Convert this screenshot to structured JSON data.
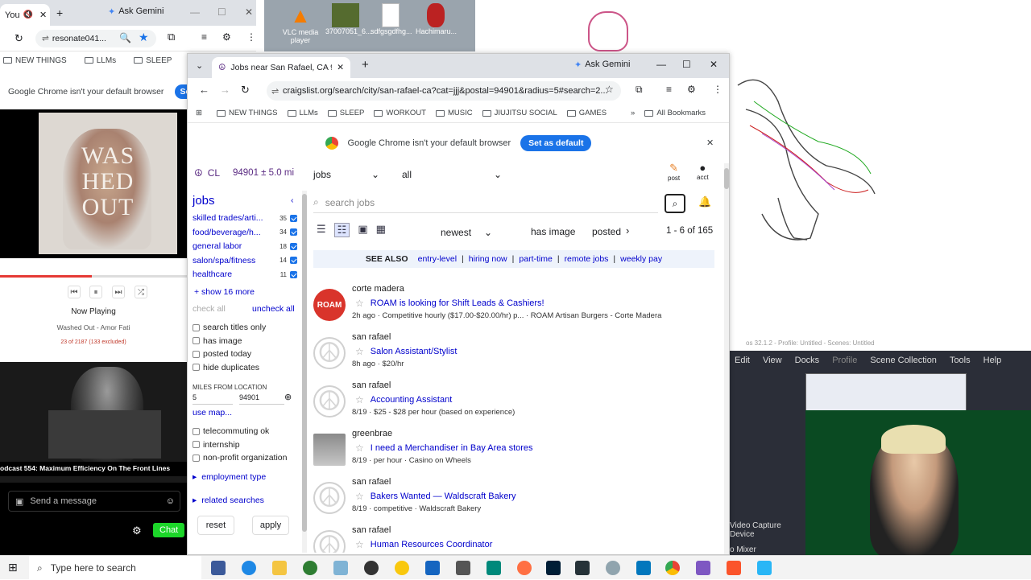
{
  "left_browser": {
    "tab1": "You",
    "tab2": "Ask Gemini",
    "url": "resonate041...",
    "bookmarks": [
      "NEW THINGS",
      "LLMs",
      "SLEEP"
    ],
    "notice": "Google Chrome isn't your default browser",
    "set_default": "Set a"
  },
  "poster": {
    "line1": "WAS",
    "line2": "HED",
    "line3": "OUT"
  },
  "player": {
    "now_playing": "Now Playing",
    "track": "Washed Out - Amor Fati",
    "position": "23 of 2187 (133 excluded)",
    "progress": 0.49
  },
  "stream": {
    "overlay": "odcast 554: Maximum Efficiency On The Front Lines",
    "send_placeholder": "Send a message",
    "chat_button": "Chat"
  },
  "desktop": {
    "icons": [
      "VLC media player",
      "37007051_6...",
      "sdfgsgdfhg...",
      "Hachimaru..."
    ]
  },
  "main": {
    "tab_title": "Jobs near San Rafael, CA 94901",
    "gemini": "Ask Gemini",
    "url": "craigslist.org/search/city/san-rafael-ca?cat=jjj&postal=94901&radius=5#search=2...",
    "bookmarks": [
      "NEW THINGS",
      "LLMs",
      "SLEEP",
      "WORKOUT",
      "MUSIC",
      "JIUJITSU SOCIAL",
      "GAMES"
    ],
    "all_bookmarks": "All Bookmarks",
    "notice": "Google Chrome isn't your default browser",
    "set_default": "Set as default"
  },
  "cl": {
    "logo": "CL",
    "location": "94901 ± 5.0 mi",
    "category": "jobs",
    "subcategory": "all",
    "post_label": "post",
    "acct_label": "acct",
    "section": "jobs",
    "search_placeholder": "search jobs",
    "sort": "newest",
    "has_image": "has image",
    "posted": "posted",
    "count": "1 - 6 of 165",
    "see_also": "SEE ALSO",
    "see_also_links": [
      "entry-level",
      "hiring now",
      "part-time",
      "remote jobs",
      "weekly pay"
    ],
    "categories": [
      {
        "name": "skilled trades/arti...",
        "count": "35"
      },
      {
        "name": "food/beverage/h...",
        "count": "34"
      },
      {
        "name": "general labor",
        "count": "18"
      },
      {
        "name": "salon/spa/fitness",
        "count": "14"
      },
      {
        "name": "healthcare",
        "count": "11"
      }
    ],
    "show_more": "+ show 16 more",
    "check_all": "check all",
    "uncheck_all": "uncheck all",
    "filters": [
      "search titles only",
      "has image",
      "posted today",
      "hide duplicates"
    ],
    "miles_label": "MILES FROM LOCATION",
    "miles": "5",
    "zip": "94901",
    "use_map": "use map...",
    "filters2": [
      "telecommuting ok",
      "internship",
      "non-profit organization"
    ],
    "employment_type": "employment type",
    "related_searches": "related searches",
    "reset": "reset",
    "apply": "apply",
    "listings": [
      {
        "loc": "corte madera",
        "title": "ROAM is looking for Shift Leads & Cashiers!",
        "meta": "2h ago · Competitive hourly ($17.00-$20.00/hr) p... · ROAM Artisan Burgers - Corte Madera",
        "thumb": "ROAM"
      },
      {
        "loc": "san rafael",
        "title": "Salon Assistant/Stylist",
        "meta": "8h ago · $20/hr",
        "thumb": ""
      },
      {
        "loc": "san rafael",
        "title": "Accounting Assistant",
        "meta": "8/19 · $25 - $28 per hour (based on experience)",
        "thumb": ""
      },
      {
        "loc": "greenbrae",
        "title": "I need a Merchandiser in Bay Area stores",
        "meta": "8/19 · per hour · Casino on Wheels",
        "thumb": ""
      },
      {
        "loc": "san rafael",
        "title": "Bakers Wanted — Waldscraft Bakery",
        "meta": "8/19 · competitive · Waldscraft Bakery",
        "thumb": ""
      },
      {
        "loc": "san rafael",
        "title": "Human Resources Coordinator",
        "meta": "",
        "thumb": ""
      }
    ]
  },
  "obs": {
    "titlebar": "os 32.1.2 - Profile: Untitled - Scenes: Untitled",
    "menu": [
      "Edit",
      "View",
      "Docks",
      "Profile",
      "Scene Collection",
      "Tools",
      "Help"
    ],
    "source1": "Video Capture Device",
    "source2": "o Mixer"
  },
  "taskbar": {
    "search": "Type here to search"
  }
}
